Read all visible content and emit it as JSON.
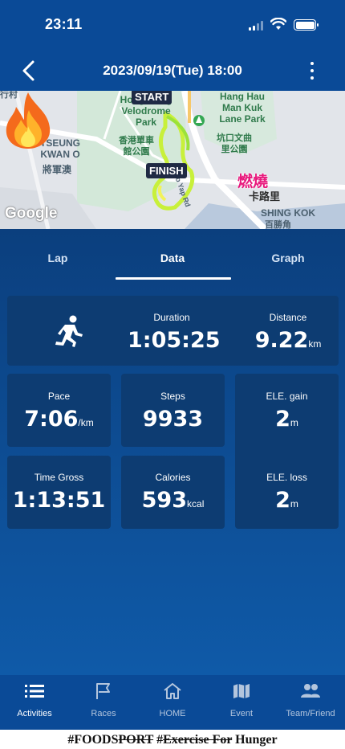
{
  "status": {
    "time": "23:11"
  },
  "header": {
    "title": "2023/09/19(Tue) 18:00"
  },
  "map": {
    "labels": {
      "velodrome": "Hong Kong\nVelodrome\nPark",
      "velodrome_zh": "香港單車\n館公園",
      "hanghau": "Hang Hau\nMan Kuk\nLane Park",
      "hanghau_zh": "坑口文曲\n里公園",
      "tseungkwano": "TSEUNG\nKWAN O",
      "tseungkwano_zh": "將軍澳",
      "shingkok": "SHING KOK",
      "shingkok_zh": "百勝角",
      "kalo": "卡路里",
      "topleft_zh": "行村",
      "road": "Po Yap Rd"
    },
    "start_label": "START",
    "finish_label": "FINISH",
    "fire_text": "燃燒",
    "google": "Google"
  },
  "tabs": [
    {
      "label": "Lap"
    },
    {
      "label": "Data"
    },
    {
      "label": "Graph"
    }
  ],
  "stats": {
    "duration": {
      "label": "Duration",
      "value": "1:05:25"
    },
    "distance": {
      "label": "Distance",
      "value": "9.22",
      "unit": "km"
    },
    "pace": {
      "label": "Pace",
      "value": "7:06",
      "unit": "/km"
    },
    "steps": {
      "label": "Steps",
      "value": "9933"
    },
    "ele_gain": {
      "label": "ELE. gain",
      "value": "2",
      "unit": "m"
    },
    "time_gross": {
      "label": "Time Gross",
      "value": "1:13:51"
    },
    "calories": {
      "label": "Calories",
      "value": "593",
      "unit": "kcal"
    },
    "ele_loss": {
      "label": "ELE. loss",
      "value": "2",
      "unit": "m"
    }
  },
  "bottom_nav": [
    {
      "label": "Activities",
      "icon": "list-icon"
    },
    {
      "label": "Races",
      "icon": "flag-icon"
    },
    {
      "label": "HOME",
      "icon": "home-icon"
    },
    {
      "label": "Event",
      "icon": "map-icon"
    },
    {
      "label": "Team/Friend",
      "icon": "people-icon"
    }
  ],
  "slogan": {
    "part1": "#FOODS",
    "part2": "PORT",
    "part3": " #",
    "part4": "Exercise For",
    "part5": " Hunger"
  },
  "colors": {
    "header_bg": "#0a4a97",
    "card_bg": "#0d3c72",
    "route": "#c8f03a",
    "fire_text": "#e8197d"
  }
}
